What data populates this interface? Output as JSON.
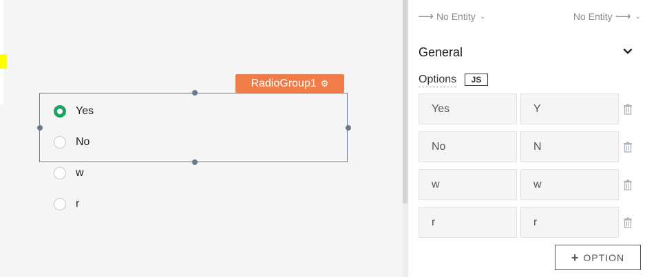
{
  "canvas": {
    "widget": {
      "name": "RadioGroup1",
      "gear_icon": "gear-icon",
      "accent_color": "#f07c48",
      "selected_color": "#1ba562"
    },
    "radio_options": [
      {
        "label": "Yes",
        "checked": true
      },
      {
        "label": "No",
        "checked": false
      },
      {
        "label": "w",
        "checked": false
      },
      {
        "label": "r",
        "checked": false
      }
    ]
  },
  "panel": {
    "entity_left": "No Entity",
    "entity_right": "No Entity",
    "section_title": "General",
    "options_label": "Options",
    "js_badge": "JS",
    "options": [
      {
        "label": "Yes",
        "value": "Y"
      },
      {
        "label": "No",
        "value": "N"
      },
      {
        "label": "w",
        "value": "w"
      },
      {
        "label": "r",
        "value": "r"
      }
    ],
    "add_option_label": "OPTION"
  }
}
